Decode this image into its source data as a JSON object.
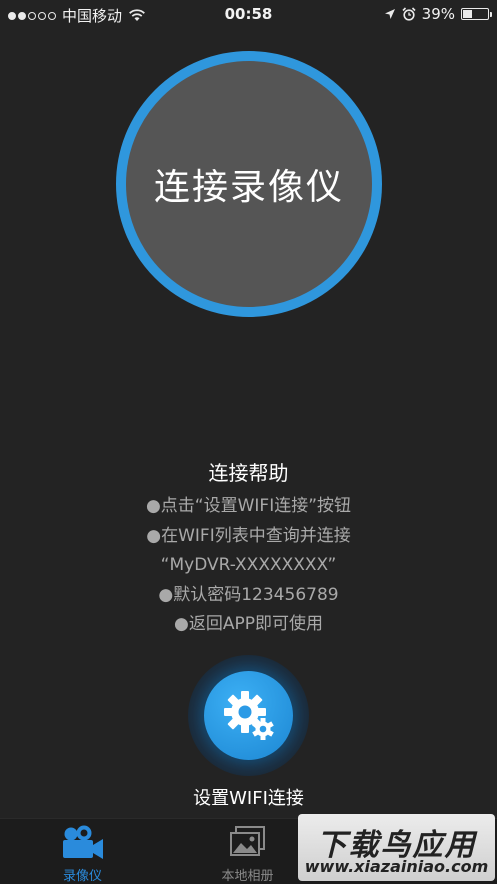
{
  "status_bar": {
    "carrier": "中国移动",
    "time": "00:58",
    "battery": "39%",
    "signal_dots_filled": 2,
    "signal_dots_total": 5,
    "battery_level": 0.39
  },
  "main": {
    "connect_button_label": "连接录像仪",
    "help_title": "连接帮助",
    "help_lines": [
      "●点击“设置WIFI连接”按钮",
      "●在WIFI列表中查询并连接",
      "“MyDVR-XXXXXXXX”",
      "●默认密码123456789",
      "●返回APP即可使用"
    ],
    "wifi_button_label": "设置WIFI连接"
  },
  "tabs": [
    {
      "label": "录像仪",
      "icon": "video-camera-icon",
      "active": true
    },
    {
      "label": "本地相册",
      "icon": "photo-album-icon",
      "active": false
    }
  ],
  "watermark": {
    "top": "下载鸟应用",
    "bottom": "www.xiazainiao.com"
  },
  "colors": {
    "accent": "#2f97dd",
    "background": "#232323",
    "tab_active": "#2a8bdc"
  }
}
